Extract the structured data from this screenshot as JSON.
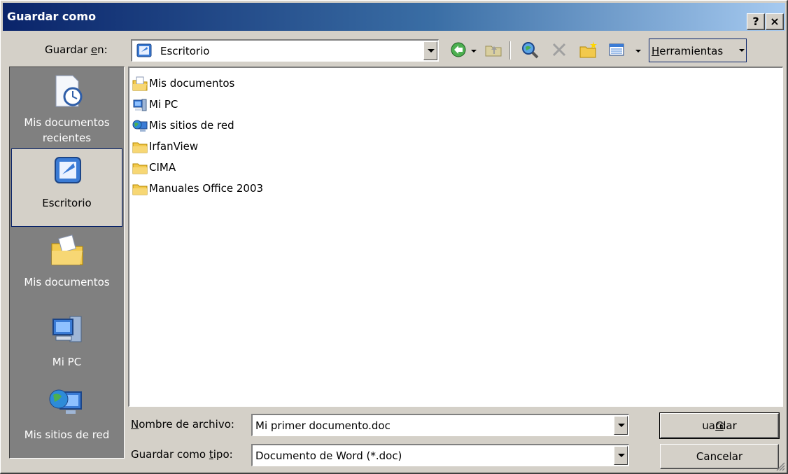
{
  "window": {
    "title": "Guardar como",
    "help_btn": "?",
    "close_btn": "×"
  },
  "save_in": {
    "label_pre": "Guardar ",
    "label_accel": "e",
    "label_post": "n:",
    "value": "Escritorio"
  },
  "toolbar": {
    "tools_pre": "",
    "tools_accel": "H",
    "tools_post": "erramientas",
    "icons": [
      "back-icon",
      "up-folder-icon",
      "search-web-icon",
      "delete-icon",
      "new-folder-icon",
      "views-icon"
    ]
  },
  "places": [
    {
      "label": "Mis documentos recientes",
      "icon": "recent-documents-icon"
    },
    {
      "label": "Escritorio",
      "icon": "desktop-icon",
      "selected": true
    },
    {
      "label": "Mis documentos",
      "icon": "my-documents-icon"
    },
    {
      "label": "Mi PC",
      "icon": "my-computer-icon"
    },
    {
      "label": "Mis sitios de red",
      "icon": "network-places-icon"
    }
  ],
  "files": [
    {
      "name": "Mis documentos",
      "icon": "my-documents-icon"
    },
    {
      "name": "Mi PC",
      "icon": "my-computer-icon"
    },
    {
      "name": "Mis sitios de red",
      "icon": "network-places-icon"
    },
    {
      "name": "IrfanView",
      "icon": "folder-icon"
    },
    {
      "name": "CIMA",
      "icon": "folder-icon"
    },
    {
      "name": "Manuales Office 2003",
      "icon": "folder-icon"
    }
  ],
  "filename": {
    "label_pre": "",
    "label_accel": "N",
    "label_post": "ombre de archivo:",
    "value": "Mi primer documento.doc"
  },
  "filetype": {
    "label_pre": "Guardar como ",
    "label_accel": "t",
    "label_post": "ipo:",
    "value": "Documento de Word (*.doc)"
  },
  "buttons": {
    "save_accel": "G",
    "save_rest": "uardar",
    "cancel": "Cancelar"
  },
  "colors": {
    "title_start": "#0a246a",
    "title_end": "#a6caf0",
    "face": "#d4d0c8",
    "places_bg": "#808080"
  }
}
